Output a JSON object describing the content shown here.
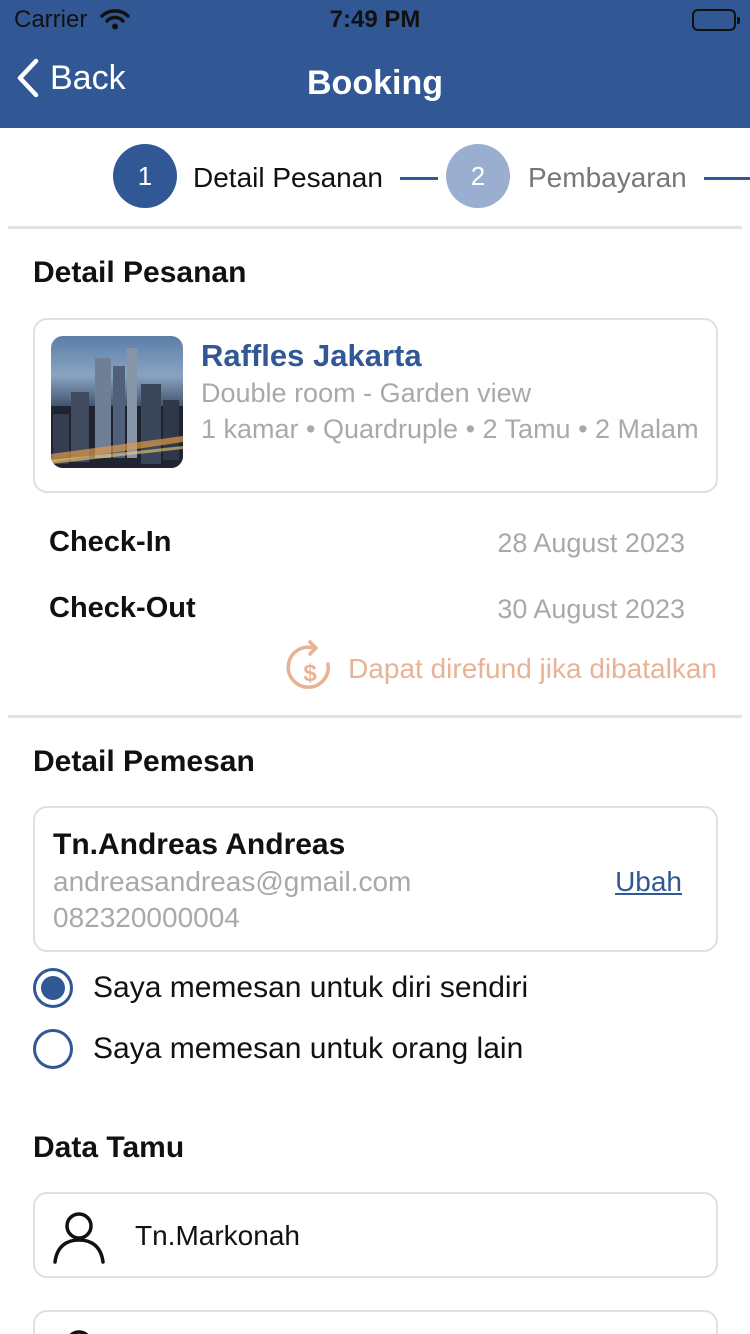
{
  "status_bar": {
    "carrier": "Carrier",
    "time": "7:49 PM"
  },
  "nav": {
    "back_label": "Back",
    "title": "Booking"
  },
  "stepper": {
    "steps": [
      {
        "number": "1",
        "label": "Detail Pesanan",
        "active": true
      },
      {
        "number": "2",
        "label": "Pembayaran",
        "active": false
      }
    ]
  },
  "order": {
    "section_title": "Detail Pesanan",
    "hotel": {
      "name": "Raffles Jakarta",
      "room": "Double room - Garden view",
      "meta": "1 kamar • Quardruple • 2 Tamu • 2 Malam"
    },
    "check_in_label": "Check-In",
    "check_in_value": "28 August 2023",
    "check_out_label": "Check-Out",
    "check_out_value": "30 August 2023",
    "refund_text": "Dapat direfund jika dibatalkan"
  },
  "booker": {
    "section_title": "Detail Pemesan",
    "name": "Tn.Andreas Andreas",
    "email": "andreasandreas@gmail.com",
    "phone": "082320000004",
    "edit_label": "Ubah",
    "options": [
      {
        "label": "Saya memesan untuk diri sendiri",
        "selected": true
      },
      {
        "label": "Saya memesan untuk orang lain",
        "selected": false
      }
    ]
  },
  "guests": {
    "section_title": "Data Tamu",
    "items": [
      {
        "name": "Tn.Markonah"
      },
      {
        "name": ""
      }
    ]
  },
  "colors": {
    "primary": "#315895",
    "step_inactive": "#9aafd0",
    "muted_text": "#a9a9a9",
    "refund": "#e8b395",
    "border": "#e0e0e0"
  }
}
